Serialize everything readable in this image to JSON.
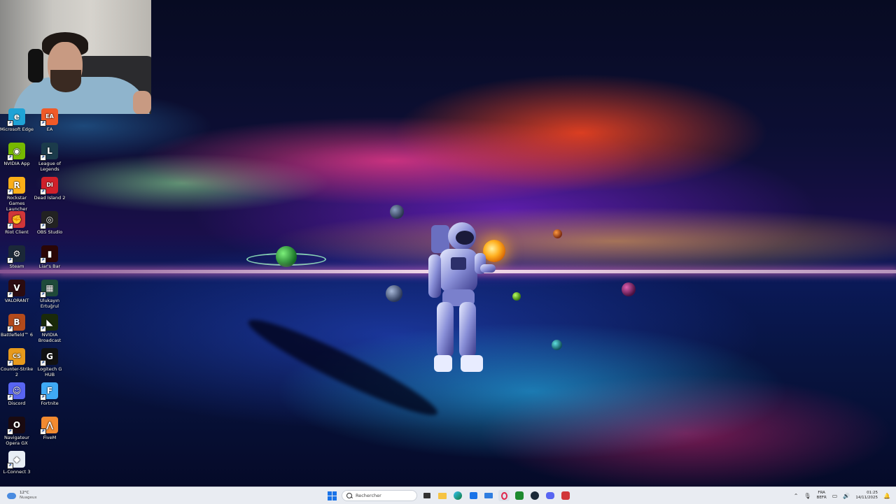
{
  "desktop": {
    "icons": [
      {
        "label": "Microsoft Edge",
        "icon": "edge-icon",
        "color": "#1fa3d6",
        "glyph": "e"
      },
      {
        "label": "EA",
        "icon": "ea-icon",
        "color": "#f05a28",
        "glyph": "EA"
      },
      {
        "label": "NVIDIA App",
        "icon": "nvidia-icon",
        "color": "#76b900",
        "glyph": "◉"
      },
      {
        "label": "League of Legends",
        "icon": "league-of-legends-icon",
        "color": "#1b3b4b",
        "glyph": "L"
      },
      {
        "label": "Rockstar Games Launcher",
        "icon": "rockstar-icon",
        "color": "#fcaf17",
        "glyph": "R"
      },
      {
        "label": "Dead Island 2",
        "icon": "dead-island-icon",
        "color": "#d0202a",
        "glyph": "DI"
      },
      {
        "label": "Riot Client",
        "icon": "riot-client-icon",
        "color": "#d13639",
        "glyph": "✊"
      },
      {
        "label": "OBS Studio",
        "icon": "obs-studio-icon",
        "color": "#222222",
        "glyph": "◎"
      },
      {
        "label": "Steam",
        "icon": "steam-icon",
        "color": "#1b2838",
        "glyph": "⚙"
      },
      {
        "label": "Liar's Bar",
        "icon": "liars-bar-icon",
        "color": "#2a0606",
        "glyph": "▮"
      },
      {
        "label": "VALORANT",
        "icon": "valorant-icon",
        "color": "#2b0b10",
        "glyph": "V"
      },
      {
        "label": "Ulukayın Ertuğrul",
        "icon": "ulukayin-icon",
        "color": "#1f4a3a",
        "glyph": "▦"
      },
      {
        "label": "Battlefield™ 6",
        "icon": "battlefield-icon",
        "color": "#b34a1b",
        "glyph": "B"
      },
      {
        "label": "NVIDIA Broadcast",
        "icon": "nvidia-broadcast-icon",
        "color": "#1a2a0a",
        "glyph": "◣"
      },
      {
        "label": "Counter-Strike 2",
        "icon": "counter-strike-icon",
        "color": "#e79a1c",
        "glyph": "CS"
      },
      {
        "label": "Logitech G HUB",
        "icon": "logitech-ghub-icon",
        "color": "#111111",
        "glyph": "G"
      },
      {
        "label": "Discord",
        "icon": "discord-icon",
        "color": "#5865f2",
        "glyph": "☺"
      },
      {
        "label": "Fortnite",
        "icon": "fortnite-icon",
        "color": "#3fa9f5",
        "glyph": "F"
      },
      {
        "label": "Navigateur Opera GX",
        "icon": "opera-gx-icon",
        "color": "#1a0a10",
        "glyph": "O"
      },
      {
        "label": "FiveM",
        "icon": "fivem-icon",
        "color": "#f28a30",
        "glyph": "⋀"
      },
      {
        "label": "L-Connect 3",
        "icon": "l-connect-icon",
        "color": "#e8eef5",
        "glyph": "◆"
      }
    ]
  },
  "taskbar": {
    "weather": {
      "temp": "12°C",
      "condition": "Nuageux"
    },
    "search_placeholder": "Rechercher",
    "language": {
      "lang": "FRA",
      "layout": "BEFR"
    },
    "clock": {
      "time": "01:25",
      "date": "14/11/2025"
    }
  },
  "colors": {
    "taskbar_bg": "#e9ecf2",
    "accent": "#1a73e8"
  }
}
